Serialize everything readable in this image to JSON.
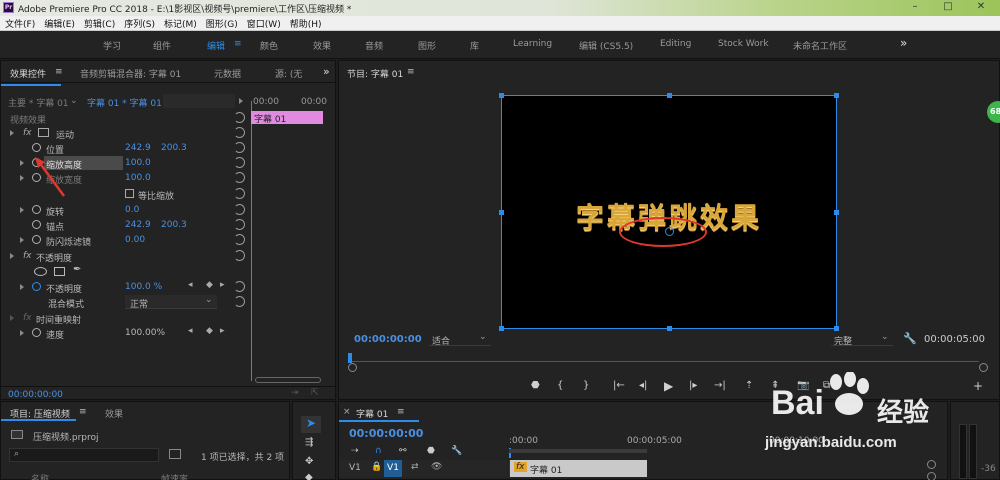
{
  "app": {
    "title": "Adobe Premiere Pro CC 2018 - E:\\1影视区\\视频号\\premiere\\工作区\\压缩视频 *",
    "logo": "Pr"
  },
  "menu": [
    "文件(F)",
    "编辑(E)",
    "剪辑(C)",
    "序列(S)",
    "标记(M)",
    "图形(G)",
    "窗口(W)",
    "帮助(H)"
  ],
  "workspaces": {
    "items": [
      "学习",
      "组件",
      "编辑",
      "颜色",
      "效果",
      "音频",
      "图形",
      "库",
      "Learning",
      "编辑 (CS5.5)",
      "Editing",
      "Stock Work",
      "未命名工作区"
    ],
    "active_index": 2,
    "more": "»"
  },
  "effect_controls": {
    "tabs": [
      "效果控件",
      "音频剪辑混合器: 字幕 01",
      "元数据",
      "源: (无"
    ],
    "master": "主要 * 字幕 01",
    "clip": "字幕 01 * 字幕 01",
    "timecode_start": "00:00",
    "timecode_end": "00:00",
    "clip_label": "字幕 01",
    "section_video": "视频效果",
    "motion": "运动",
    "position": {
      "label": "位置",
      "x": "242.9",
      "y": "200.3"
    },
    "scale_height": {
      "label": "缩放高度",
      "value": "100.0"
    },
    "scale_width": {
      "label": "缩放宽度",
      "value": "100.0"
    },
    "uniform_scale": "等比缩放",
    "rotation": {
      "label": "旋转",
      "value": "0.0"
    },
    "anchor": {
      "label": "锚点",
      "x": "242.9",
      "y": "200.3"
    },
    "antiflicker": {
      "label": "防闪烁滤镜",
      "value": "0.00"
    },
    "opacity_section": "不透明度",
    "opacity": {
      "label": "不透明度",
      "value": "100.0 %"
    },
    "blend": {
      "label": "混合模式",
      "value": "正常"
    },
    "time_remap": "时间重映射",
    "speed": {
      "label": "速度",
      "value": "100.00%"
    },
    "footer_time": "00:00:00:00"
  },
  "program_monitor": {
    "tab": "节目: 字幕 01",
    "title_text": "字幕弹跳效果",
    "timecode": "00:00:00:00",
    "fit": "适合",
    "quality": "完整",
    "duration": "00:00:05:00",
    "badge": "68"
  },
  "project": {
    "tabs": [
      "项目: 压缩视频",
      "效果"
    ],
    "file": "压缩视频.prproj",
    "selection": "1 项已选择，共 2 项",
    "column_a": "名称",
    "column_b": "帧速率"
  },
  "timeline": {
    "tab": "字幕 01",
    "timecode": "00:00:00:00",
    "ruler": [
      ":00:00",
      "00:00:05:00",
      "00:00:10:00"
    ],
    "track": "V1",
    "source_patch": "V1",
    "clip_label": "字幕 01",
    "fx": "fx"
  },
  "audio_meter": {
    "label": "-36"
  },
  "watermark": {
    "brand": "Bai",
    "brand_cn": "经验",
    "url": "jingyan.baidu.com"
  },
  "colors": {
    "accent": "#2d8ceb",
    "clip_pink": "#e08be0",
    "annotation": "#e0392b",
    "title_gold": "#d9a63a"
  }
}
